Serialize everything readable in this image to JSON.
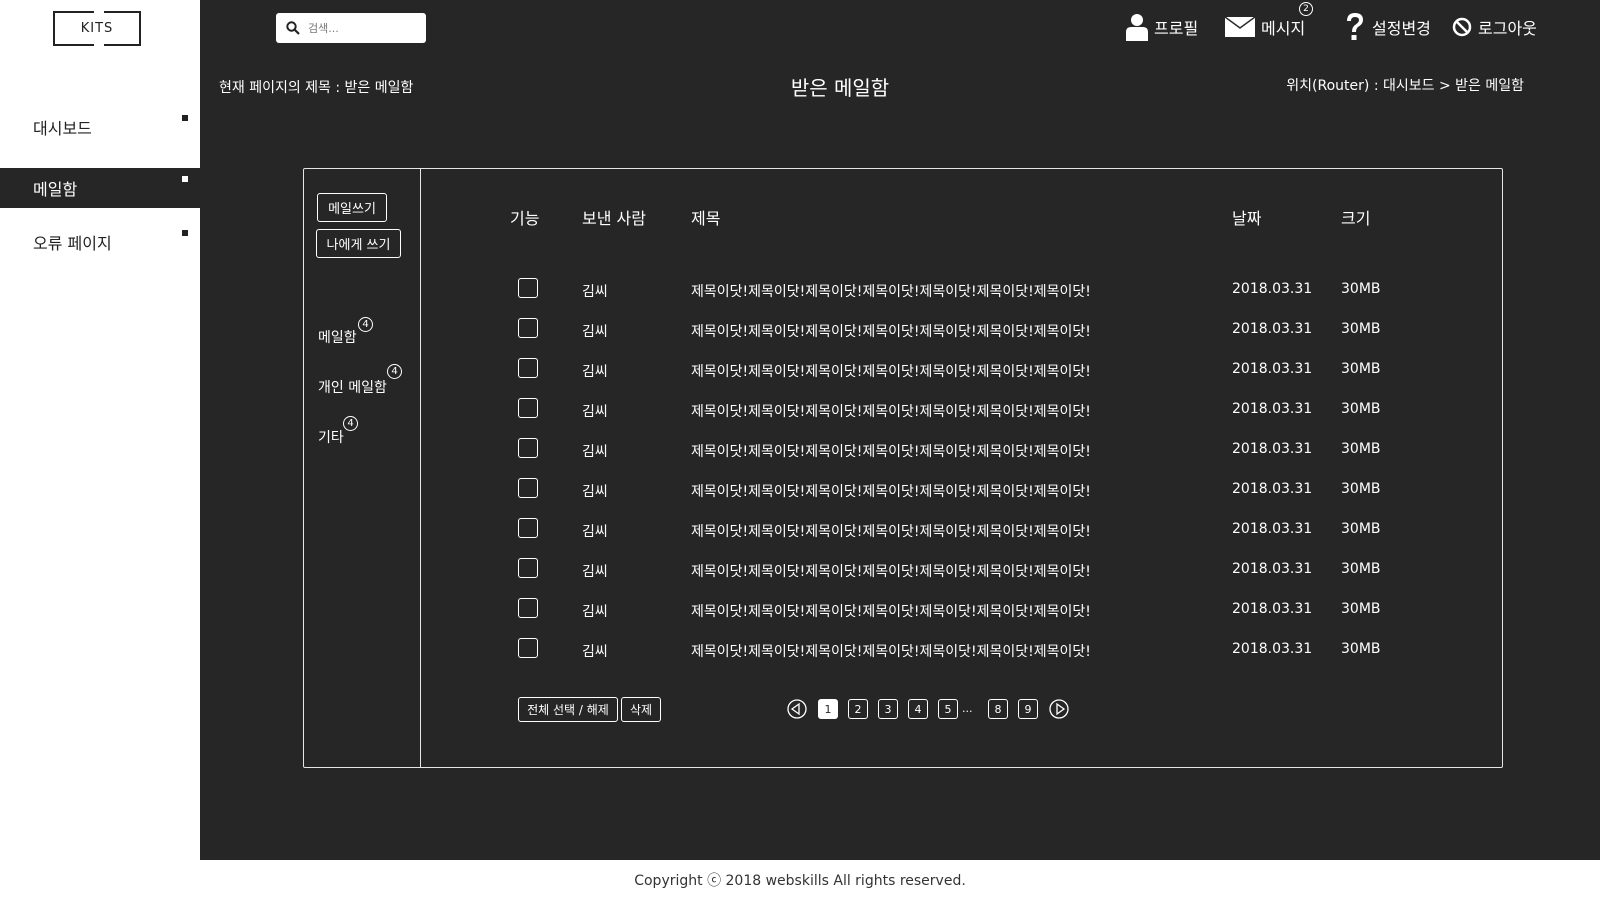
{
  "brand": {
    "logo_text": "KITS"
  },
  "sidebar": {
    "items": [
      {
        "label": "대시보드",
        "active": false
      },
      {
        "label": "메일함",
        "active": true
      },
      {
        "label": "오류 페이지",
        "active": false
      }
    ]
  },
  "search": {
    "placeholder": "검색..."
  },
  "topnav": {
    "profile": "프로필",
    "message": "메시지",
    "message_badge": "2",
    "settings": "설정변경",
    "logout": "로그아웃"
  },
  "page": {
    "current_label": "현재 페이지의 제목 : 받은 메일함",
    "title": "받은 메일함",
    "breadcrumb": "위치(Router) : 대시보드 > 받은 메일함"
  },
  "mail_sidebar": {
    "compose": "메일쓰기",
    "write_to_me": "나에게 쓰기",
    "folders": [
      {
        "label": "메일함",
        "count": "4"
      },
      {
        "label": "개인 메일함",
        "count": "4"
      },
      {
        "label": "기타",
        "count": "4"
      }
    ]
  },
  "table": {
    "headers": {
      "function": "기능",
      "sender": "보낸 사람",
      "subject": "제목",
      "date": "날짜",
      "size": "크기"
    },
    "rows": [
      {
        "sender": "김씨",
        "subject": "제목이닷!제목이닷!제목이닷!제목이닷!제목이닷!제목이닷!제목이닷!",
        "date": "2018.03.31",
        "size": "30MB"
      },
      {
        "sender": "김씨",
        "subject": "제목이닷!제목이닷!제목이닷!제목이닷!제목이닷!제목이닷!제목이닷!",
        "date": "2018.03.31",
        "size": "30MB"
      },
      {
        "sender": "김씨",
        "subject": "제목이닷!제목이닷!제목이닷!제목이닷!제목이닷!제목이닷!제목이닷!",
        "date": "2018.03.31",
        "size": "30MB"
      },
      {
        "sender": "김씨",
        "subject": "제목이닷!제목이닷!제목이닷!제목이닷!제목이닷!제목이닷!제목이닷!",
        "date": "2018.03.31",
        "size": "30MB"
      },
      {
        "sender": "김씨",
        "subject": "제목이닷!제목이닷!제목이닷!제목이닷!제목이닷!제목이닷!제목이닷!",
        "date": "2018.03.31",
        "size": "30MB"
      },
      {
        "sender": "김씨",
        "subject": "제목이닷!제목이닷!제목이닷!제목이닷!제목이닷!제목이닷!제목이닷!",
        "date": "2018.03.31",
        "size": "30MB"
      },
      {
        "sender": "김씨",
        "subject": "제목이닷!제목이닷!제목이닷!제목이닷!제목이닷!제목이닷!제목이닷!",
        "date": "2018.03.31",
        "size": "30MB"
      },
      {
        "sender": "김씨",
        "subject": "제목이닷!제목이닷!제목이닷!제목이닷!제목이닷!제목이닷!제목이닷!",
        "date": "2018.03.31",
        "size": "30MB"
      },
      {
        "sender": "김씨",
        "subject": "제목이닷!제목이닷!제목이닷!제목이닷!제목이닷!제목이닷!제목이닷!",
        "date": "2018.03.31",
        "size": "30MB"
      },
      {
        "sender": "김씨",
        "subject": "제목이닷!제목이닷!제목이닷!제목이닷!제목이닷!제목이닷!제목이닷!",
        "date": "2018.03.31",
        "size": "30MB"
      }
    ]
  },
  "actions": {
    "select_all": "전체 선택 / 해제",
    "delete": "삭제"
  },
  "pagination": {
    "pages": [
      "1",
      "2",
      "3",
      "4",
      "5"
    ],
    "ellipsis": "...",
    "tail_pages": [
      "8",
      "9"
    ],
    "current": "1"
  },
  "footer": {
    "copyright": "Copyright ⓒ 2018 webskills All rights reserved."
  },
  "colors": {
    "background": "#262626",
    "sidebar": "#ffffff",
    "foreground": "#ffffff"
  }
}
